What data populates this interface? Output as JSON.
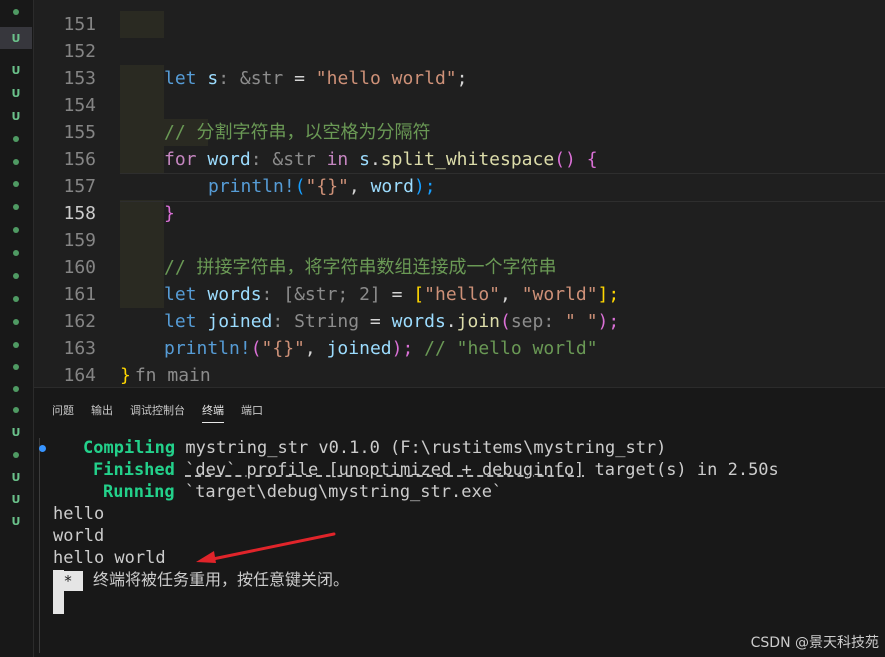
{
  "gutter": {
    "markers": [
      "dot",
      "u",
      "dot",
      "u",
      "u",
      "u",
      "dot",
      "dot",
      "dot",
      "dot",
      "dot",
      "dot",
      "dot",
      "dot",
      "dot",
      "dot",
      "dot",
      "dot",
      "dot",
      "dot",
      "dot",
      "dot",
      "dot",
      "u",
      "dot",
      "u",
      "u",
      "u"
    ],
    "u_label": "U"
  },
  "editor": {
    "lines": [
      {
        "num": "151"
      },
      {
        "num": "152"
      },
      {
        "num": "153"
      },
      {
        "num": "154"
      },
      {
        "num": "155"
      },
      {
        "num": "156"
      },
      {
        "num": "157"
      },
      {
        "num": "158"
      },
      {
        "num": "159"
      },
      {
        "num": "160"
      },
      {
        "num": "161"
      },
      {
        "num": "162"
      },
      {
        "num": "163"
      },
      {
        "num": "164"
      }
    ],
    "tokens": {
      "l152": [
        "let",
        " s",
        ": ",
        "&str",
        " = ",
        "\"hello world\"",
        ";"
      ],
      "l154": "// 分割字符串，以空格为分隔符",
      "l155": [
        "for",
        " word",
        ": ",
        "&str",
        " in ",
        "s",
        ".",
        "split_whitespace",
        "()",
        " {"
      ],
      "l156": [
        "println!",
        "(",
        "\"{}\"",
        ", ",
        "word",
        ");"
      ],
      "l157": "}",
      "l159": "// 拼接字符串，将字符串数组连接成一个字符串",
      "l160": [
        "let",
        " words",
        ": ",
        "[&str; 2]",
        " = ",
        "[",
        "\"hello\"",
        ", ",
        "\"world\"",
        "];"
      ],
      "l161": [
        "let",
        " joined",
        ": ",
        "String",
        " = ",
        "words",
        ".",
        "join",
        "(",
        "sep: ",
        "\" \"",
        ");"
      ],
      "l162": [
        "println!",
        "(",
        "\"{}\"",
        ", ",
        "joined",
        ");",
        " // \"hello world\""
      ],
      "l163": [
        "}",
        "fn main"
      ]
    }
  },
  "panel": {
    "tabs": [
      "问题",
      "输出",
      "调试控制台",
      "终端",
      "端口"
    ],
    "active_tab": "终端",
    "terminal": {
      "compiling_label": "Compiling",
      "compiling_text": " mystring_str v0.1.0 (F:\\rustitems\\mystring_str)",
      "finished_label": "Finished",
      "finished_profile": "`dev` profile [unoptimized + debuginfo]",
      "finished_text": " target(s) in 2.50s",
      "running_label": "Running",
      "running_text": " `target\\debug\\mystring_str.exe`",
      "out1": "hello",
      "out2": "world",
      "out3": "hello world",
      "star": "*",
      "reuse_msg": "终端将被任务重用，按任意键关闭。"
    }
  },
  "watermark": "CSDN @景天科技苑",
  "colors": {
    "accent": "#3794ff",
    "arrow": "#e0242a",
    "green": "#23d18b"
  }
}
